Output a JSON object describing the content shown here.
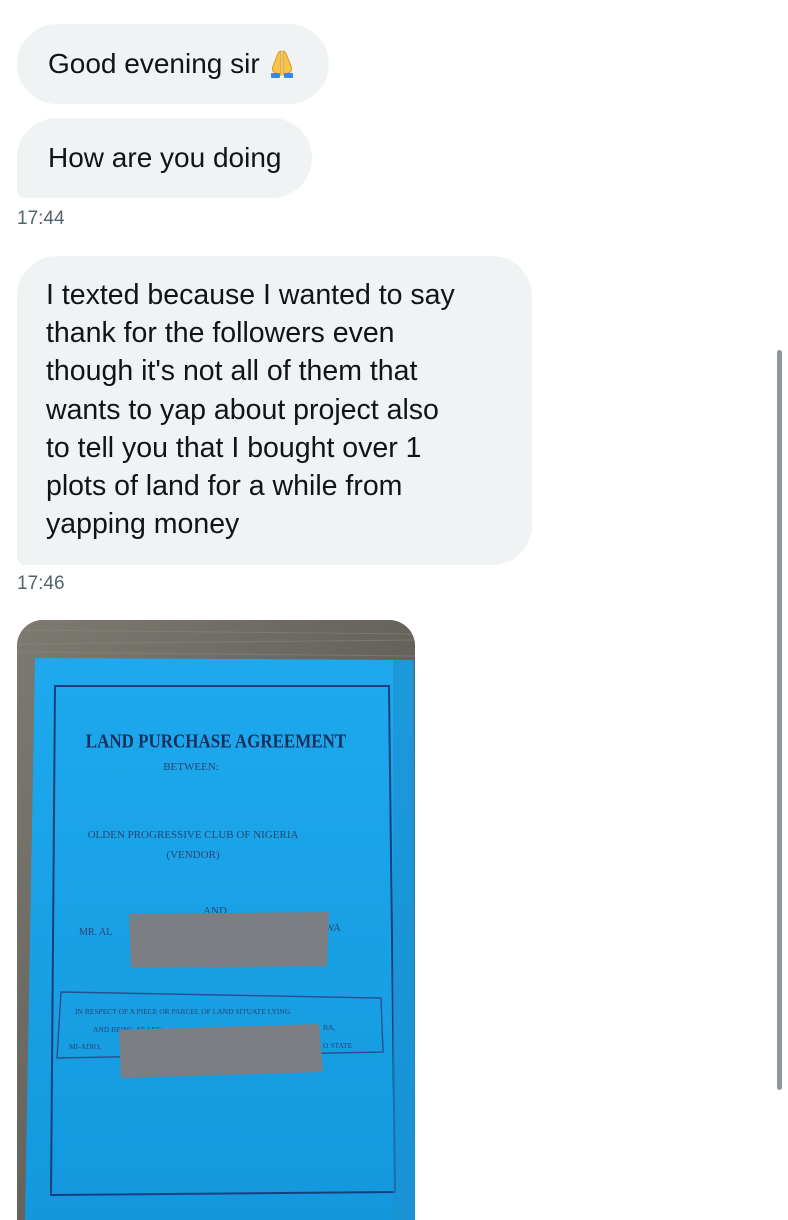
{
  "messages": [
    {
      "text": "Good evening sir",
      "emoji": "folded-hands"
    },
    {
      "text": "How are you doing"
    },
    {
      "text": "I texted because I wanted to say\nthank for the followers even\nthough it's not all of them that\nwants to yap about project also\nto tell you that I bought over 1\nplots of land for a while from\nyapping money"
    }
  ],
  "timestamps": [
    "17:44",
    "17:46"
  ],
  "attachment": {
    "heading": "LAND PURCHASE AGREEMENT",
    "between": "BETWEEN:",
    "party1_line1": "OLDEN PROGRESSIVE CLUB OF NIGERIA",
    "party1_line2": "(VENDOR)",
    "and": "AND",
    "party2_left": "MR. AL",
    "party2_right": "WA",
    "respect_line1": "IN RESPECT OF A PIECE OR PARCEL OF LAND SITUATE LYING",
    "respect_line2": "AND BEING AT ARE",
    "respect_line2_right": "BA,",
    "respect_line3_left": "MI-ADIO,",
    "respect_line3_right": "O STATE"
  },
  "colors": {
    "bubble": "#eff3f4",
    "timestamp": "#536471",
    "document_blue": "#1fa4e8",
    "redaction": "#7b7f84"
  }
}
